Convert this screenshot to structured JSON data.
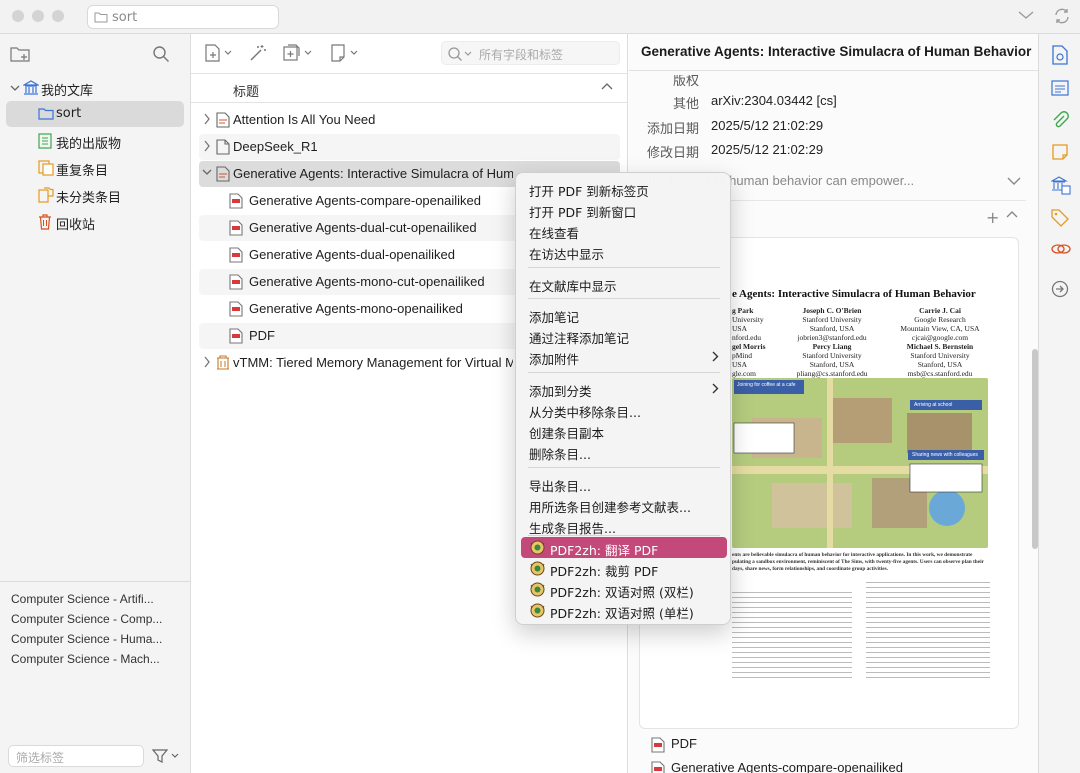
{
  "titlebar": {
    "tab_label": "sort"
  },
  "sidebar": {
    "items": [
      {
        "label": "我的文库"
      },
      {
        "label": "sort"
      },
      {
        "label": "我的出版物"
      },
      {
        "label": "重复条目"
      },
      {
        "label": "未分类条目"
      },
      {
        "label": "回收站"
      }
    ],
    "tags": [
      "Computer Science - Artifi...",
      "Computer Science - Comp...",
      "Computer Science - Huma...",
      "Computer Science - Mach..."
    ],
    "tag_filter_placeholder": "筛选标签"
  },
  "middle": {
    "search_placeholder": "所有字段和标签",
    "column_title": "标题",
    "rows": [
      {
        "title": "Attention Is All You Need"
      },
      {
        "title": "DeepSeek_R1"
      },
      {
        "title": "Generative Agents: Interactive Simulacra of Human Behavior"
      },
      {
        "title": "Generative Agents-compare-openailiked"
      },
      {
        "title": "Generative Agents-dual-cut-openailiked"
      },
      {
        "title": "Generative Agents-dual-openailiked"
      },
      {
        "title": "Generative Agents-mono-cut-openailiked"
      },
      {
        "title": "Generative Agents-mono-openailiked"
      },
      {
        "title": "PDF"
      },
      {
        "title": "vTMM: Tiered Memory Management for Virtual Machines"
      }
    ]
  },
  "right": {
    "title": "Generative Agents: Interactive Simulacra of Human Behavior",
    "meta": [
      {
        "key": "版权",
        "value": ""
      },
      {
        "key": "其他",
        "value": "arXiv:2304.03442 [cs]"
      },
      {
        "key": "添加日期",
        "value": "2025/5/12 21:02:29"
      },
      {
        "key": "修改日期",
        "value": "2025/5/12 21:02:29"
      }
    ],
    "abstract": "able proxies of human behavior can empower...",
    "preview": {
      "title": "e Agents: Interactive Simulacra of Human Behavior",
      "authors": [
        {
          "name": "g Park",
          "aff": "University\nUSA\nnford.edu"
        },
        {
          "name": "Joseph C. O'Brien",
          "aff": "Stanford University\nStanford, USA\njobrien3@stanford.edu"
        },
        {
          "name": "Carrie J. Cai",
          "aff": "Google Research\nMountain View, CA, USA\ncjcai@google.com"
        },
        {
          "name": "gel Morris",
          "aff": "pMind\nUSA\ngle.com"
        },
        {
          "name": "Percy Liang",
          "aff": "Stanford University\nStanford, USA\npliang@cs.stanford.edu"
        },
        {
          "name": "Michael S. Bernstein",
          "aff": "Stanford University\nStanford, USA\nmsb@cs.stanford.edu"
        }
      ],
      "caption": "ents are believable simulacra of human behavior for interactive applications. In this work, we demonstrate pulating a sandbox environment, reminiscent of The Sims, with twenty-five agents. Users can observe plan their days, share news, form relationships, and coordinate group activities.",
      "scene_labels": [
        "Joining for coffee at a cafe",
        "Arriving at school",
        "Sharing news with colleagues"
      ]
    },
    "attachments": [
      "PDF",
      "Generative Agents-compare-openailiked"
    ]
  },
  "context_menu": {
    "groups": [
      [
        "打开 PDF 到新标签页",
        "打开 PDF 到新窗口",
        "在线查看",
        "在访达中显示"
      ],
      [
        "在文献库中显示"
      ],
      [
        "添加笔记",
        "通过注释添加笔记",
        "添加附件"
      ],
      [
        "添加到分类",
        "从分类中移除条目...",
        "创建条目副本",
        "删除条目..."
      ],
      [
        "导出条目...",
        "用所选条目创建参考文献表...",
        "生成条目报告..."
      ],
      [
        "PDF2zh: 翻译 PDF",
        "PDF2zh: 裁剪 PDF",
        "PDF2zh: 双语对照 (双栏)",
        "PDF2zh: 双语对照 (单栏)"
      ]
    ],
    "highlighted": "PDF2zh: 翻译 PDF",
    "highlight_color": "#c2497a"
  }
}
